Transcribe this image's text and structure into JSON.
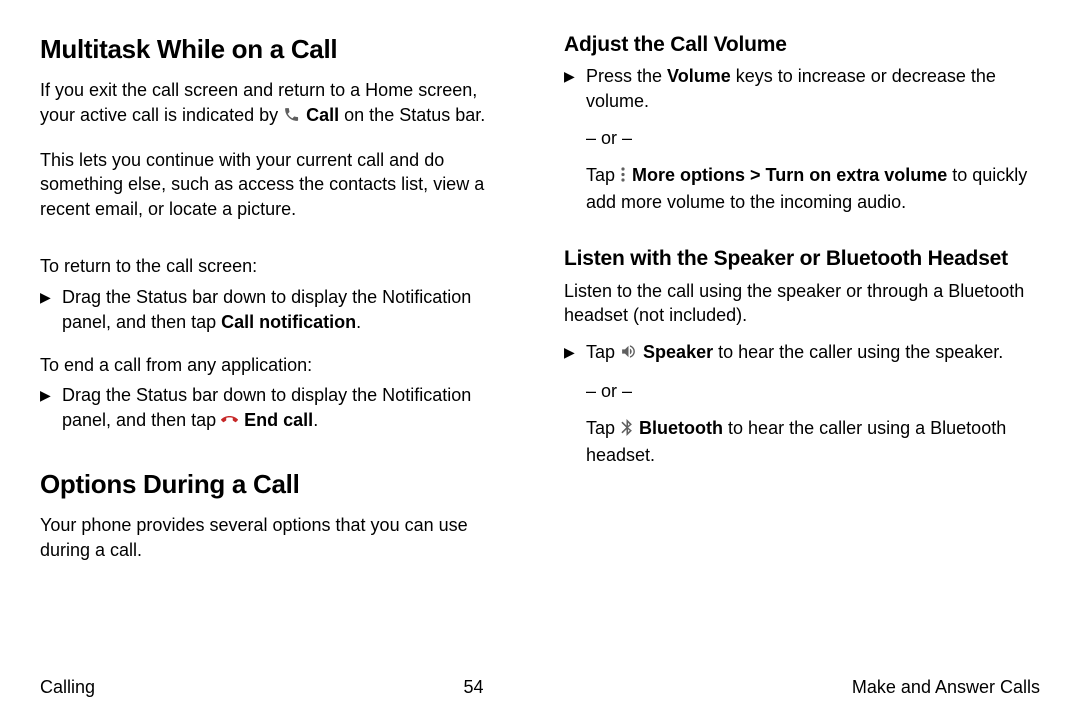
{
  "left": {
    "h1a": "Multitask While on a Call",
    "p1_pre": "If you exit the call screen and return to a Home screen, your active call is indicated by ",
    "p1_call": "Call",
    "p1_post": " on the Status bar.",
    "p2": "This lets you continue with your current call and do something else, such as access the contacts list, view a recent email, or locate a picture.",
    "p3": "To return to the call screen:",
    "b1_pre": "Drag the Status bar down to display the Notification panel, and then tap ",
    "b1_bold": "Call notification",
    "b1_post": ".",
    "p4": "To end a call from any application:",
    "b2_pre": "Drag the Status bar down to display the Notification panel, and then tap ",
    "b2_bold": "End call",
    "b2_post": ".",
    "h1b": "Options During a Call",
    "p5": "Your phone provides several options that you can use during a call."
  },
  "right": {
    "h2a": "Adjust the Call Volume",
    "b1_pre": "Press the ",
    "b1_bold": "Volume",
    "b1_post": " keys to increase or decrease the volume.",
    "or": "– or –",
    "c1_pre": "Tap ",
    "c1_bold": "More options > Turn on extra volume",
    "c1_post": " to quickly add more volume to the incoming audio.",
    "h2b": "Listen with the Speaker or Bluetooth Headset",
    "p1": "Listen to the call using the speaker or through a Bluetooth headset (not included).",
    "b2_pre": "Tap ",
    "b2_bold": "Speaker",
    "b2_post": " to hear the caller using the speaker.",
    "c2_pre": "Tap ",
    "c2_bold": "Bluetooth",
    "c2_post": " to hear the caller using a Bluetooth headset."
  },
  "footer": {
    "left": "Calling",
    "center": "54",
    "right": "Make and Answer Calls"
  }
}
